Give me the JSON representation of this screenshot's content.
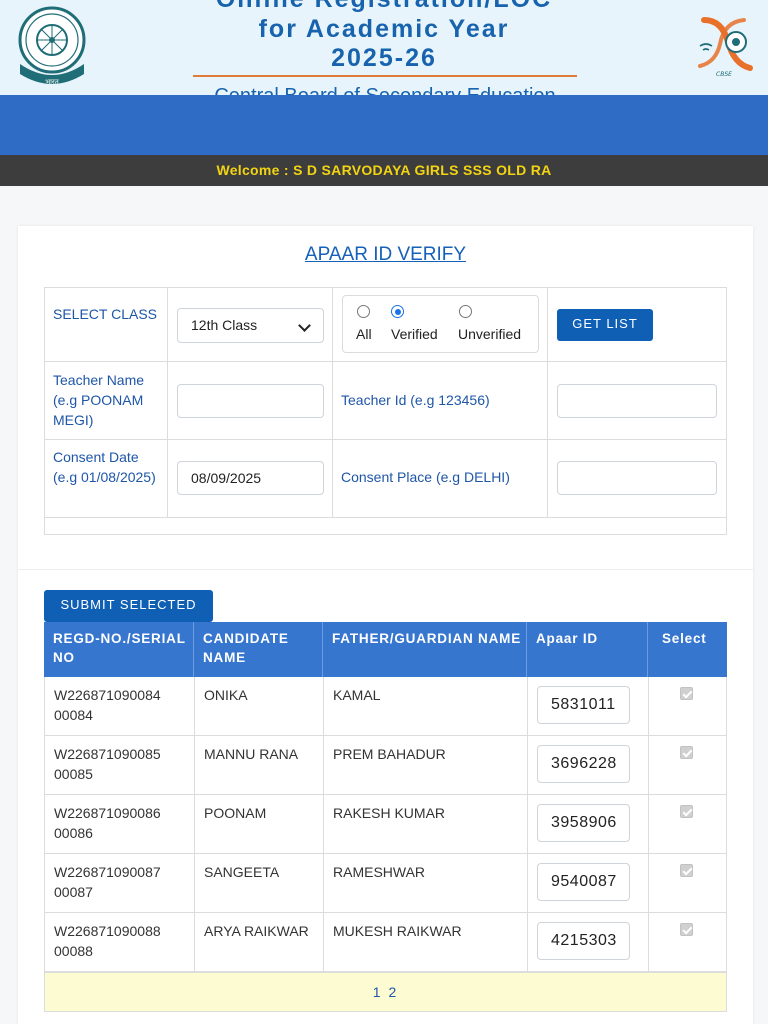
{
  "header": {
    "title_line1": "Online Registration/LOC",
    "title_line2": "for Academic Year",
    "title_line3": "2025-26",
    "subtitle": "Central Board of Secondary Education",
    "left_logo_text": "भारत",
    "right_logo_text": "CBSE",
    "colors": {
      "title": "#1763ad",
      "rule": "#e07b3a",
      "band": "#2f6cc6"
    }
  },
  "welcome": "Welcome : S D SARVODAYA GIRLS SSS OLD RA",
  "page_title": "APAAR ID VERIFY",
  "filters": {
    "select_class_label": "SELECT CLASS",
    "select_class_value": "12th Class",
    "radio": {
      "all": "All",
      "verified": "Verified",
      "unverified": "Unverified",
      "selected": "Verified"
    },
    "get_list_label": "GET LIST",
    "teacher_name_label": "Teacher Name (e.g POONAM MEGI)",
    "teacher_name_value": "",
    "teacher_id_label": "Teacher Id (e.g 123456)",
    "teacher_id_value": "",
    "consent_date_label": "Consent Date (e.g 01/08/2025)",
    "consent_date_value": "08/09/2025",
    "consent_place_label": "Consent Place (e.g DELHI)",
    "consent_place_value": ""
  },
  "submit_label": "SUBMIT SELECTED",
  "table": {
    "headers": {
      "regd": "REGD-NO./SERIAL NO",
      "candidate": "CANDIDATE NAME",
      "father": "FATHER/GUARDIAN NAME",
      "apaar": "Apaar ID",
      "select": "Select"
    },
    "rows": [
      {
        "regd": "W226871090084",
        "serial": "00084",
        "name": "ONIKA",
        "father": "KAMAL",
        "apaar": "5831011",
        "selected": true
      },
      {
        "regd": "W226871090085",
        "serial": "00085",
        "name": "MANNU RANA",
        "father": "PREM BAHADUR",
        "apaar": "3696228",
        "selected": true
      },
      {
        "regd": "W226871090086",
        "serial": "00086",
        "name": "POONAM",
        "father": "RAKESH KUMAR",
        "apaar": "3958906",
        "selected": true
      },
      {
        "regd": "W226871090087",
        "serial": "00087",
        "name": "SANGEETA",
        "father": "RAMESHWAR",
        "apaar": "9540087",
        "selected": true
      },
      {
        "regd": "W226871090088",
        "serial": "00088",
        "name": "ARYA RAIKWAR",
        "father": "MUKESH RAIKWAR",
        "apaar": "4215303",
        "selected": true
      }
    ]
  },
  "pagination": {
    "pages": "1 2",
    "page_1": "1",
    "page_2": "2"
  }
}
